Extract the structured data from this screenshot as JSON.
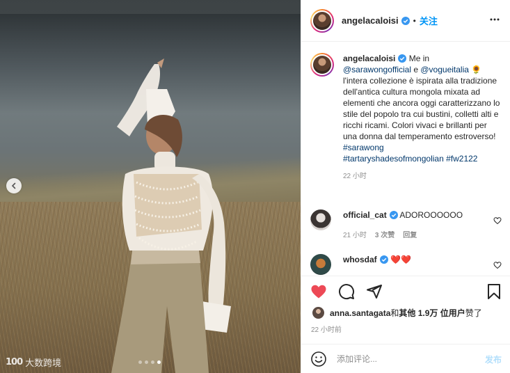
{
  "photo": {
    "carousel_total": 4,
    "carousel_active": 3,
    "watermark_text": "大数跨境",
    "watermark_logo": "100"
  },
  "header": {
    "username": "angelacaloisi",
    "separator": "•",
    "follow_label": "关注"
  },
  "caption": {
    "username": "angelacaloisi",
    "text_intro": " Me in",
    "mention_1": "@sarawongofficial",
    "conj": " e ",
    "mention_2": "@vogueitalia",
    "emoji": " 🌻",
    "body": "l'intera collezione è ispirata alla tradizione dell'antica cultura mongola mixata ad elementi che ancora oggi caratterizzano lo stile del popolo tra cui bustini, colletti alti e ricchi ricami. Colori vivaci e brillanti per una donna dal temperamento estroverso!",
    "hashtag_1": "#sarawong",
    "hashtag_2": "#tartaryshadesofmongolian",
    "hashtag_3": "#fw2122",
    "time": "22 小时"
  },
  "comments": [
    {
      "username": "official_cat",
      "text": "ADOROOOOOO",
      "time": "21 小时",
      "likes": "3 次赞",
      "reply": "回复"
    },
    {
      "username": "whosdaf",
      "text": "❤️❤️"
    }
  ],
  "likes": {
    "user": "anna.santagata",
    "and": " 和 ",
    "others": "其他 1.9万 位用户",
    "suffix": " 赞了"
  },
  "post_time": "22 小时前",
  "add_comment": {
    "placeholder": "添加评论...",
    "post_label": "发布"
  },
  "colors": {
    "accent": "#0095f6",
    "like_red": "#ed4956",
    "verified_blue": "#3897f0"
  }
}
